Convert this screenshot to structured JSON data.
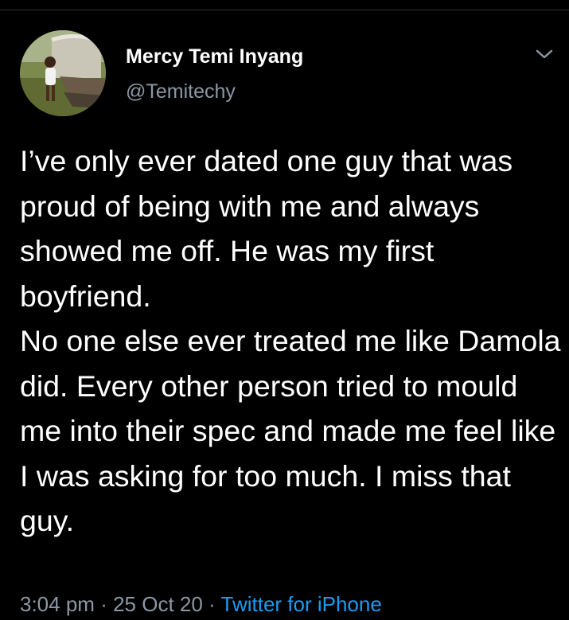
{
  "tweet": {
    "author_name": "Mercy Temi Inyang",
    "author_handle": "@Temitechy",
    "paragraphs": [
      "I’ve only ever dated one guy that was proud of being with me and always showed me off. He was my first boyfriend.",
      "No one else ever treated me like Damola did. Every other person tried to mould me into their spec and made me feel like I was asking for too much. I miss that guy."
    ],
    "time": "3:04 pm",
    "separator": "·",
    "date": "25 Oct 20",
    "source": "Twitter for iPhone"
  },
  "icons": {
    "more": "chevron-down-icon",
    "avatar": "profile-photo"
  },
  "colors": {
    "background": "#000000",
    "text_primary": "#ffffff",
    "text_secondary": "#8b98a5",
    "link": "#1d9bf0"
  }
}
